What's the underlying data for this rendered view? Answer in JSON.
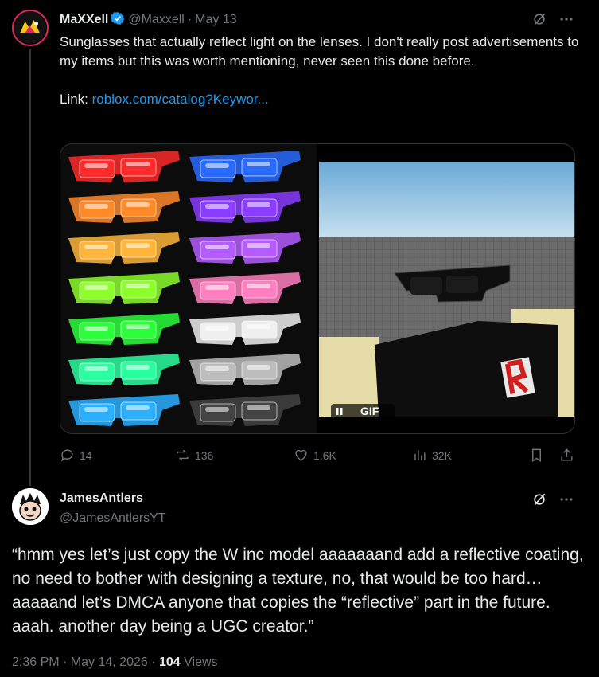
{
  "original_tweet": {
    "display_name": "MaXXell",
    "handle": "@Maxxell",
    "separator": "·",
    "date": "May 13",
    "text_line1": "Sunglasses that actually reflect light on the lenses. I don't really post advertisements to my items but this was worth mentioning, never seen this done before.",
    "link_label": "Link: ",
    "link_text": "roblox.com/catalog?Keywor...",
    "gif_label": "GIF",
    "stats": {
      "replies": "14",
      "retweets": "136",
      "likes": "1.6K",
      "views": "32K"
    }
  },
  "reply": {
    "display_name": "JamesAntlers",
    "handle": "@JamesAntlersYT",
    "text": "“hmm yes let’s just copy the W inc model aaaaaaand add a reflective coating, no need to bother with designing a texture, no, that would be too hard… aaaaand let’s DMCA anyone that copies the “reflective” part in the future. aaah. another day being a UGC creator.”",
    "time": "2:36 PM · May 14, 2026 · ",
    "views_count": "104",
    "views_label": " Views"
  },
  "colors": {
    "background": "#000000",
    "text": "#e7e9ea",
    "muted": "#71767b",
    "link": "#1d9bf0",
    "verified": "#1d9bf0",
    "thread_line": "#333639"
  },
  "glasses_colors": [
    "#ff2a2a",
    "#2a6bff",
    "#ff8a2a",
    "#8a3cff",
    "#ffb53a",
    "#b55cff",
    "#8dff2a",
    "#ff7fc0",
    "#2aff3a",
    "#f0f0f0",
    "#2affa0",
    "#bdbdbd",
    "#2ab0ff",
    "#444444"
  ]
}
